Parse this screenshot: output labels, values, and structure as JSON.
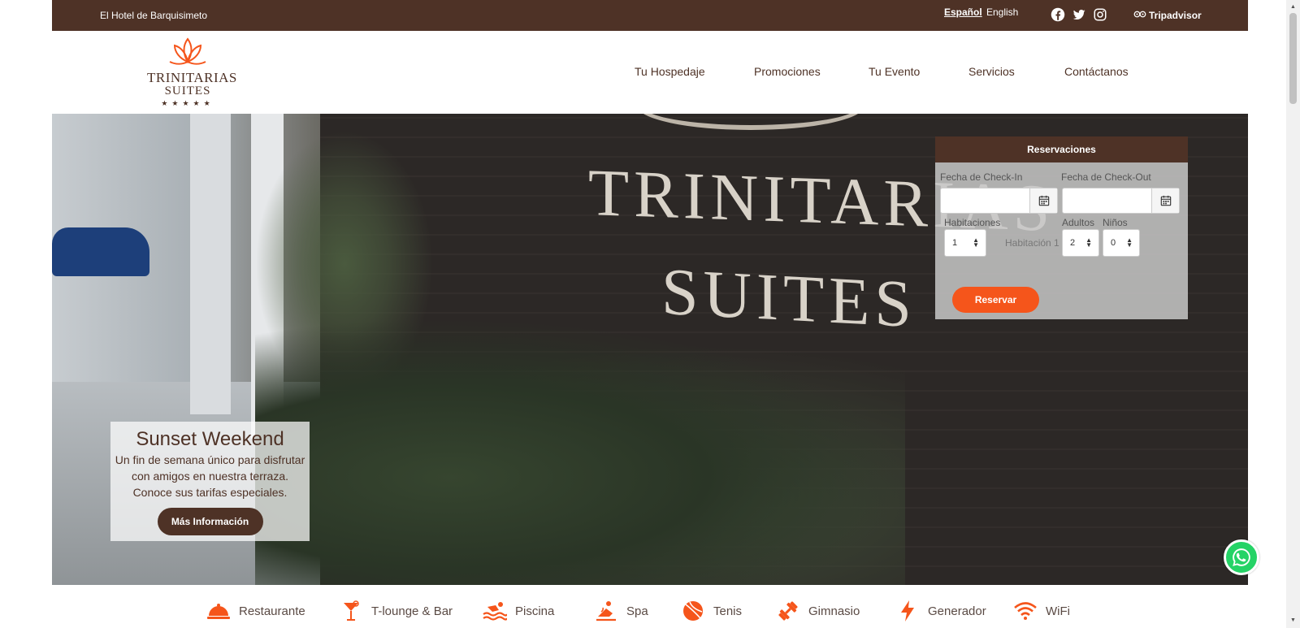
{
  "topbar": {
    "tagline": "El Hotel de Barquisimeto",
    "lang_es": "Español",
    "lang_en": "English",
    "social": [
      "facebook-icon",
      "twitter-icon",
      "instagram-icon"
    ],
    "tripadvisor": "Tripadvisor"
  },
  "header": {
    "logo": {
      "line1": "TRINITARIAS",
      "line2": "SUITES",
      "stars": "★★★★★"
    },
    "nav": [
      "Tu Hospedaje",
      "Promociones",
      "Tu Evento",
      "Servicios",
      "Contáctanos"
    ]
  },
  "hero": {
    "sign_line1": "TRINITARIAS",
    "sign_line2": "SUITES"
  },
  "promo": {
    "title": "Sunset Weekend",
    "text": "Un fin de semana único para disfrutar con amigos en nuestra terraza. Conoce sus tarifas especiales.",
    "button": "Más Información"
  },
  "booking": {
    "title": "Reservaciones",
    "checkin_label": "Fecha de Check-In",
    "checkout_label": "Fecha de Check-Out",
    "rooms_label": "Habitaciones",
    "rooms_value": "1",
    "room_label": "Habitación 1",
    "adults_label": "Adultos",
    "adults_value": "2",
    "children_label": "Niños",
    "children_value": "0",
    "submit": "Reservar"
  },
  "amenities": [
    "Restaurante",
    "T-lounge & Bar",
    "Piscina",
    "Spa",
    "Tenis",
    "Gimnasio",
    "Generador",
    "WiFi"
  ],
  "colors": {
    "brown": "#4e3226",
    "accent": "#f5551b",
    "whatsapp": "#25d366"
  }
}
